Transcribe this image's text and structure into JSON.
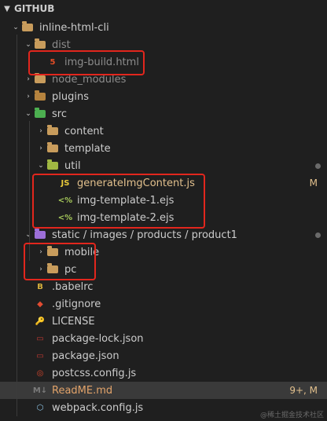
{
  "header": {
    "title": "GITHUB"
  },
  "tree": [
    {
      "label": "inline-html-cli",
      "icon": "folder-open-icon",
      "arrow": "down",
      "indent": 0,
      "style": "normal"
    },
    {
      "label": "dist",
      "icon": "folder-open-icon",
      "arrow": "down",
      "indent": 1,
      "style": "dim"
    },
    {
      "label": "img-build.html",
      "icon": "html5-icon",
      "arrow": "",
      "indent": 2,
      "style": "dim"
    },
    {
      "label": "node_modules",
      "icon": "folder-icon",
      "arrow": "right",
      "indent": 1,
      "style": "dim"
    },
    {
      "label": "plugins",
      "icon": "plugins-folder-icon",
      "arrow": "right",
      "indent": 1,
      "style": "normal"
    },
    {
      "label": "src",
      "icon": "src-folder-icon",
      "arrow": "down",
      "indent": 1,
      "style": "normal"
    },
    {
      "label": "content",
      "icon": "folder-icon",
      "arrow": "right",
      "indent": 2,
      "style": "normal"
    },
    {
      "label": "template",
      "icon": "folder-icon",
      "arrow": "right",
      "indent": 2,
      "style": "normal"
    },
    {
      "label": "util",
      "icon": "util-folder-icon",
      "arrow": "down",
      "indent": 2,
      "style": "normal",
      "dot": true
    },
    {
      "label": "generateImgContent.js",
      "icon": "js-icon",
      "arrow": "",
      "indent": 3,
      "style": "yellow",
      "badge": "M"
    },
    {
      "label": "img-template-1.ejs",
      "icon": "ejs-icon",
      "arrow": "",
      "indent": 3,
      "style": "normal"
    },
    {
      "label": "img-template-2.ejs",
      "icon": "ejs-icon",
      "arrow": "",
      "indent": 3,
      "style": "normal"
    },
    {
      "label": "static / images / products / product1",
      "icon": "folder-open-icon",
      "arrow": "down",
      "indent": 1,
      "style": "normal",
      "dot": true
    },
    {
      "label": "mobile",
      "icon": "folder-icon",
      "arrow": "right",
      "indent": 2,
      "style": "normal"
    },
    {
      "label": "pc",
      "icon": "folder-icon",
      "arrow": "right",
      "indent": 2,
      "style": "normal"
    },
    {
      "label": ".babelrc",
      "icon": "babel-icon",
      "arrow": "",
      "indent": 1,
      "style": "normal"
    },
    {
      "label": ".gitignore",
      "icon": "git-icon",
      "arrow": "",
      "indent": 1,
      "style": "normal"
    },
    {
      "label": "LICENSE",
      "icon": "license-icon",
      "arrow": "",
      "indent": 1,
      "style": "normal"
    },
    {
      "label": "package-lock.json",
      "icon": "npm-icon",
      "arrow": "",
      "indent": 1,
      "style": "normal"
    },
    {
      "label": "package.json",
      "icon": "npm-icon",
      "arrow": "",
      "indent": 1,
      "style": "normal"
    },
    {
      "label": "postcss.config.js",
      "icon": "postcss-icon",
      "arrow": "",
      "indent": 1,
      "style": "normal"
    },
    {
      "label": "ReadME.md",
      "icon": "markdown-icon",
      "arrow": "",
      "indent": 1,
      "style": "orange",
      "badge": "9+, M",
      "selected": true
    },
    {
      "label": "webpack.config.js",
      "icon": "webpack-icon",
      "arrow": "",
      "indent": 1,
      "style": "normal"
    }
  ],
  "icons": {
    "html5-icon": "5",
    "js-icon": "JS",
    "ejs-icon": "<%",
    "babel-icon": "B",
    "git-icon": "◆",
    "license-icon": "🔑",
    "npm-icon": "▭",
    "postcss-icon": "◎",
    "markdown-icon": "M↓",
    "webpack-icon": "⬡"
  },
  "colors": {
    "background": "#1f1f1f",
    "selected": "#3a3a3a",
    "highlight_box": "#e2261d",
    "modified": "#e2c08d",
    "warning": "#e2a36a"
  },
  "watermark": "@稀土掘金技术社区"
}
